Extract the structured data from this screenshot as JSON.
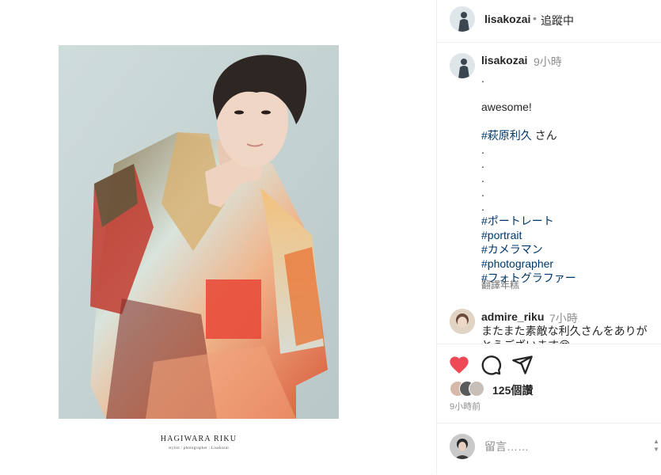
{
  "post": {
    "photo_caption_title": "HAGIWARA RIKU",
    "photo_caption_sub": "stylist / photographer : Lisakozai"
  },
  "header": {
    "username": "lisakozai",
    "separator": "•",
    "follow_state": "追蹤中"
  },
  "caption": {
    "username": "lisakozai",
    "time": "9小時",
    "lines": [
      {
        "text": "."
      },
      {
        "text": ""
      },
      {
        "text": "awesome!"
      },
      {
        "text": ""
      },
      {
        "hashtag": "#萩原利久",
        "suffix": " さん"
      },
      {
        "text": "."
      },
      {
        "text": "."
      },
      {
        "text": "."
      },
      {
        "text": "."
      },
      {
        "text": "."
      },
      {
        "hashtag": "#ポートレート"
      },
      {
        "hashtag": "#portrait"
      },
      {
        "hashtag": "#カメラマン"
      },
      {
        "hashtag": "#photographer"
      },
      {
        "hashtag": "#フォトグラファー"
      }
    ],
    "translate_label": "翻譯年糕"
  },
  "comment": {
    "username": "admire_riku",
    "time": "7小時",
    "text": "またまた素敵な利久さんをありがとうございます😍"
  },
  "actions": {
    "likes": "125個讚",
    "posted": "9小時前",
    "icons": [
      "heart-filled-icon",
      "comment-bubble-icon",
      "share-plane-icon"
    ]
  },
  "add_comment": {
    "placeholder": "留言……"
  },
  "colors": {
    "like": "#ed4956",
    "hashtag": "#00376b",
    "muted": "#8e8e8e",
    "border": "#efefef"
  }
}
